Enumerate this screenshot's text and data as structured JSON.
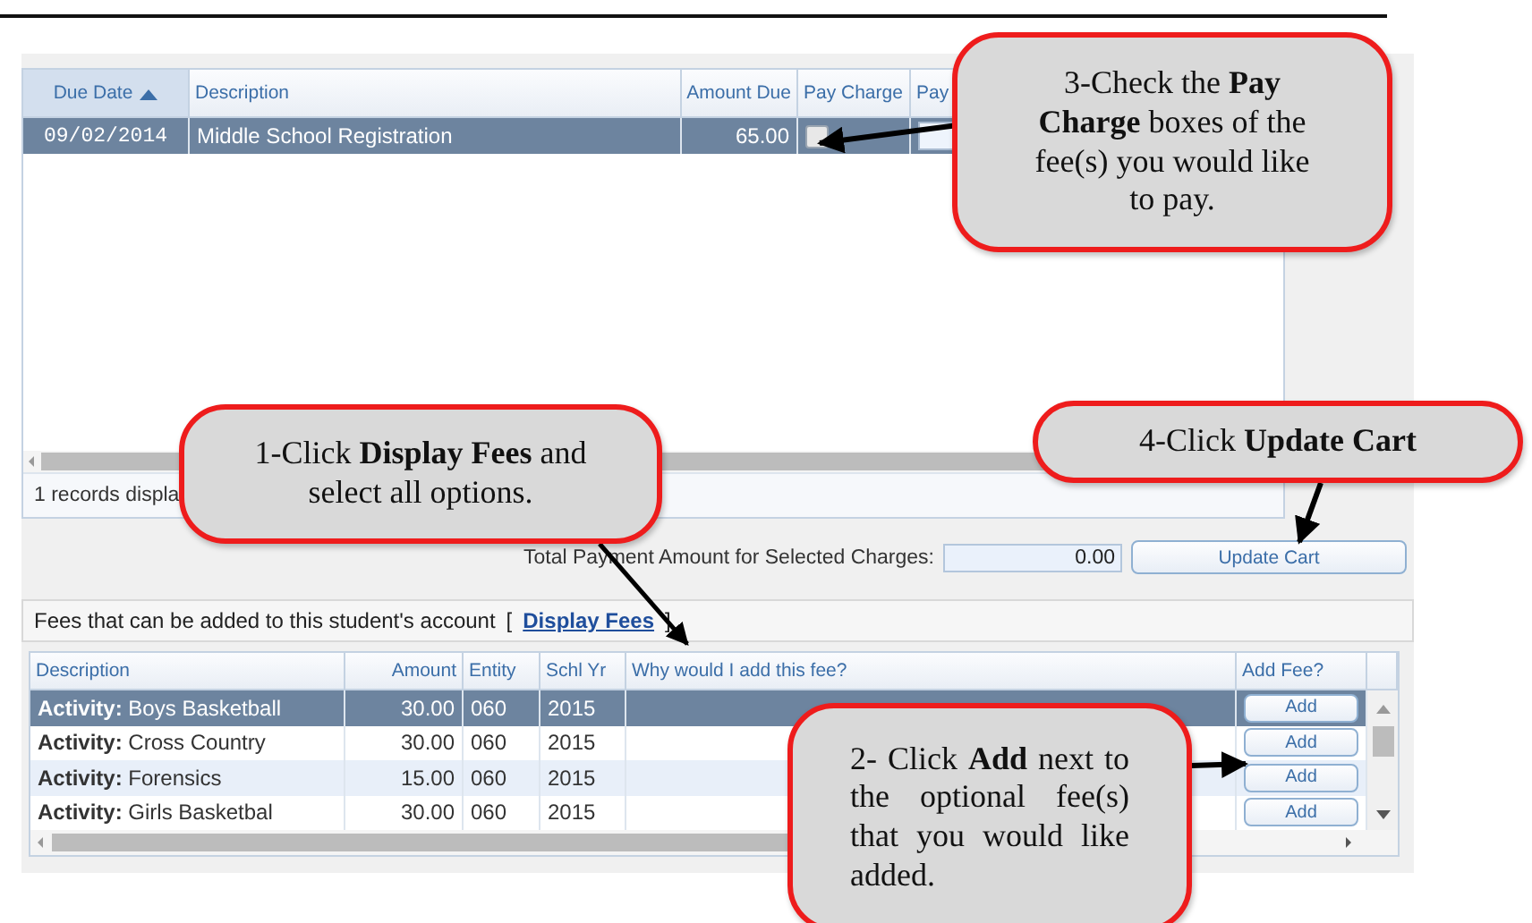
{
  "payments_grid": {
    "columns": [
      {
        "label": "Due Date",
        "sorted": true
      },
      {
        "label": "Description",
        "sorted": false
      },
      {
        "label": "Amount Due",
        "sorted": false
      },
      {
        "label": "Pay Charge",
        "sorted": false
      },
      {
        "label": "Pay",
        "sorted": false
      }
    ],
    "rows": [
      {
        "due_date": "09/02/2014",
        "description": "Middle School Registration",
        "amount_due": "65.00",
        "pay_charge": false,
        "selected": true
      }
    ],
    "status": "1 records displa"
  },
  "total": {
    "label": "Total Payment Amount for Selected Charges:",
    "value": "0.00",
    "button": "Update Cart"
  },
  "fees_section": {
    "title": "Fees that can be added to this student's account",
    "bracket_open": "[",
    "link": "Display Fees",
    "bracket_close": "]"
  },
  "fees_grid": {
    "columns": [
      "Description",
      "Amount",
      "Entity",
      "Schl Yr",
      "Why would I add this fee?",
      "Add Fee?"
    ],
    "rows": [
      {
        "description": "**Activity:** Boys Basketball",
        "amount": "30.00",
        "entity": "060",
        "school_year": "2015",
        "button": "Add",
        "selected": true
      },
      {
        "description": "**Activity:** Cross Country",
        "amount": "30.00",
        "entity": "060",
        "school_year": "2015",
        "button": "Add",
        "selected": false
      },
      {
        "description": "**Activity:** Forensics",
        "amount": "15.00",
        "entity": "060",
        "school_year": "2015",
        "button": "Add",
        "selected": false
      },
      {
        "description": "**Activity:** Girls Basketbal",
        "amount": "30.00",
        "entity": "060",
        "school_year": "2015",
        "button": "Add",
        "selected": false
      }
    ]
  },
  "callouts": [
    {
      "text": "3-Check the **Pay Charge** boxes of the fee(s) you would like to pay."
    },
    {
      "text": "4-Click **Update Cart**"
    },
    {
      "text": "1-Click **Display Fees** and select all options."
    },
    {
      "text": "2- Click **Add** next to the optional fee(s) that you would like added."
    }
  ]
}
